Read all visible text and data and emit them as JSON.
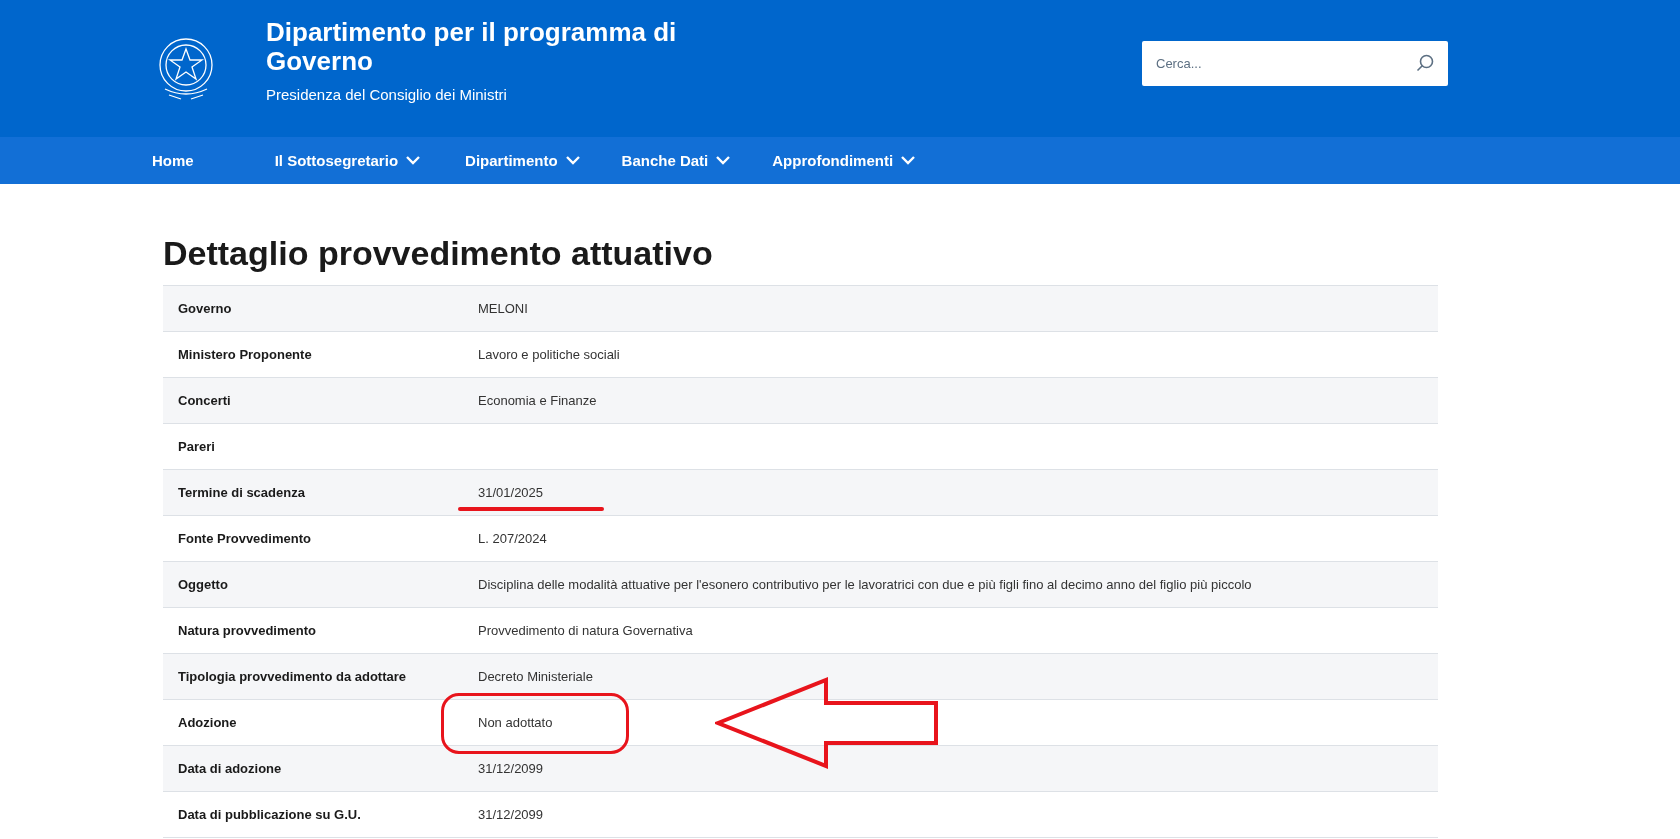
{
  "header": {
    "title": "Dipartimento per il programma di Governo",
    "subtitle": "Presidenza del Consiglio dei Ministri",
    "search": {
      "placeholder": "Cerca..."
    }
  },
  "nav": [
    {
      "label": "Home",
      "has_menu": false
    },
    {
      "label": "Il Sottosegretario",
      "has_menu": true
    },
    {
      "label": "Dipartimento",
      "has_menu": true
    },
    {
      "label": "Banche Dati",
      "has_menu": true
    },
    {
      "label": "Approfondimenti",
      "has_menu": true
    }
  ],
  "page_title": "Dettaglio provvedimento attuativo",
  "rows": [
    {
      "label": "Governo",
      "value": "MELONI",
      "underlined": false,
      "circled": false,
      "arrow": false
    },
    {
      "label": "Ministero Proponente",
      "value": "Lavoro e politiche sociali",
      "underlined": false,
      "circled": false,
      "arrow": false
    },
    {
      "label": "Concerti",
      "value": "Economia e Finanze",
      "underlined": false,
      "circled": false,
      "arrow": false
    },
    {
      "label": "Pareri",
      "underlined": false,
      "circled": false,
      "arrow": false
    },
    {
      "label": "Termine di scadenza",
      "value": "31/01/2025",
      "underlined": true,
      "circled": false,
      "arrow": false
    },
    {
      "label": "Fonte Provvedimento",
      "value": "L. 207/2024",
      "underlined": false,
      "circled": false,
      "arrow": false
    },
    {
      "label": "Oggetto",
      "value": "Disciplina delle modalità attuative per l'esonero contributivo per le lavoratrici con due e più figli fino al decimo anno del figlio più piccolo",
      "underlined": false,
      "circled": false,
      "arrow": false
    },
    {
      "label": "Natura provvedimento",
      "value": "Provvedimento di natura Governativa",
      "underlined": false,
      "circled": false,
      "arrow": false
    },
    {
      "label": "Tipologia provvedimento da adottare",
      "value": "Decreto Ministeriale",
      "underlined": false,
      "circled": false,
      "arrow": false
    },
    {
      "label": "Adozione",
      "value": "Non adottato",
      "underlined": false,
      "circled": true,
      "arrow": true
    },
    {
      "label": "Data di adozione",
      "value": "31/12/2099",
      "underlined": false,
      "circled": false,
      "arrow": false
    },
    {
      "label": "Data di pubblicazione su G.U.",
      "value": "31/12/2099",
      "underlined": false,
      "circled": false,
      "arrow": false
    }
  ]
}
